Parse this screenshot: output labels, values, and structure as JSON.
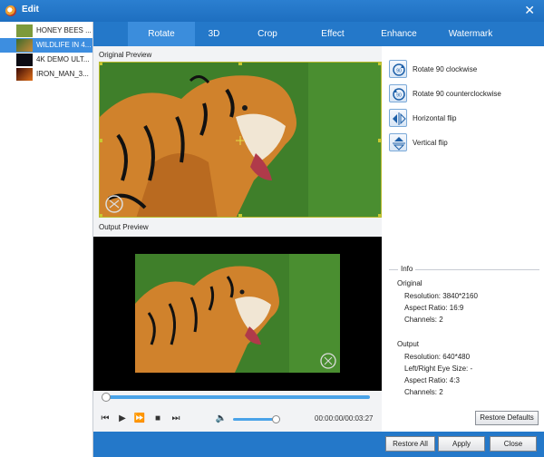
{
  "window": {
    "title": "Edit",
    "close_icon": "close-icon"
  },
  "files": [
    {
      "name": "HONEY BEES ...",
      "thumb_color": "#6e8f3a",
      "selected": false
    },
    {
      "name": "WILDLIFE IN 4...",
      "thumb_color": "#4b6a34",
      "selected": true
    },
    {
      "name": "4K DEMO ULT...",
      "thumb_color": "#101020",
      "selected": false
    },
    {
      "name": "IRON_MAN_3...",
      "thumb_color": "#b44a1a",
      "selected": false
    }
  ],
  "tabs": [
    {
      "label": "Rotate",
      "active": true
    },
    {
      "label": "3D",
      "active": false
    },
    {
      "label": "Crop",
      "active": false
    },
    {
      "label": "Effect",
      "active": false
    },
    {
      "label": "Enhance",
      "active": false
    },
    {
      "label": "Watermark",
      "active": false
    }
  ],
  "preview": {
    "original_label": "Original Preview",
    "output_label": "Output Preview"
  },
  "player": {
    "seek_progress": 0,
    "volume_level": 0.9,
    "time": "00:00:00/00:03:27"
  },
  "operations": [
    {
      "label": "Rotate 90 clockwise",
      "icon": "rotate-clockwise-icon"
    },
    {
      "label": "Rotate 90 counterclockwise",
      "icon": "rotate-counterclockwise-icon"
    },
    {
      "label": "Horizontal flip",
      "icon": "horizontal-flip-icon"
    },
    {
      "label": "Vertical flip",
      "icon": "vertical-flip-icon"
    }
  ],
  "info": {
    "title": "Info",
    "original_heading": "Original",
    "original_resolution": "Resolution: 3840*2160",
    "original_aspect": "Aspect Ratio: 16:9",
    "original_channels": "Channels: 2",
    "output_heading": "Output",
    "output_resolution": "Resolution: 640*480",
    "output_eye_size": "Left/Right Eye Size: -",
    "output_aspect": "Aspect Ratio: 4:3",
    "output_channels": "Channels: 2"
  },
  "buttons": {
    "restore_defaults": "Restore Defaults",
    "restore_all": "Restore All",
    "apply": "Apply",
    "close": "Close"
  },
  "colors": {
    "accent": "#2478c9",
    "selected": "#3d8ee0",
    "crop_border": "#b8ba2c"
  }
}
